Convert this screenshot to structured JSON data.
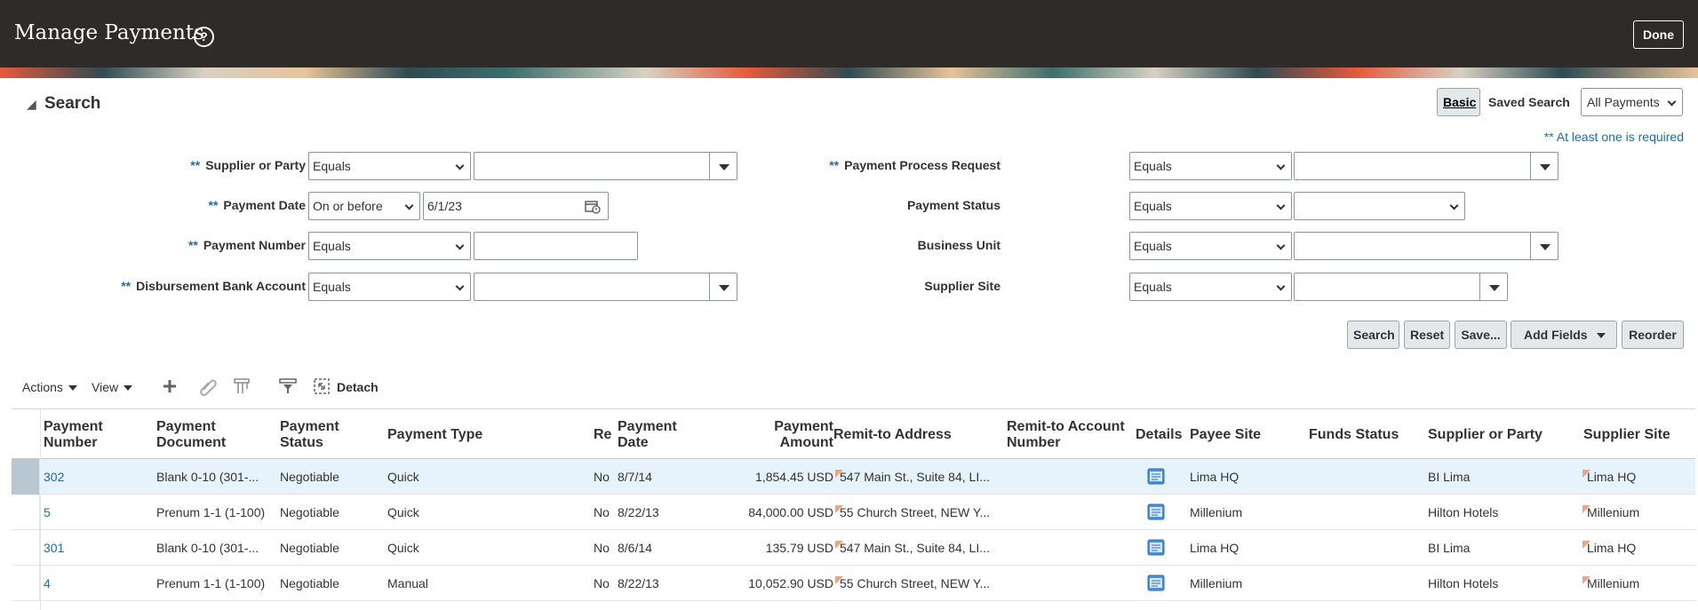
{
  "header": {
    "title": "Manage Payments",
    "help_label": "?",
    "done_label": "Done"
  },
  "search": {
    "title": "Search",
    "basic_label": "Basic",
    "saved_search_label": "Saved Search",
    "saved_search_value": "All Payments",
    "required_note": "** At least one is required",
    "required_mark": "**",
    "left_fields": [
      {
        "label": "Supplier or Party",
        "required": true,
        "operator": "Equals",
        "value": ""
      },
      {
        "label": "Payment Date",
        "required": true,
        "operator": "On or before",
        "value": "6/1/23"
      },
      {
        "label": "Payment Number",
        "required": true,
        "operator": "Equals",
        "value": ""
      },
      {
        "label": "Disbursement Bank Account",
        "required": true,
        "operator": "Equals",
        "value": ""
      }
    ],
    "right_fields": [
      {
        "label": "Payment Process Request",
        "required": true,
        "operator": "Equals",
        "value": ""
      },
      {
        "label": "Payment Status",
        "required": false,
        "operator": "Equals",
        "value": ""
      },
      {
        "label": "Business Unit",
        "required": false,
        "operator": "Equals",
        "value": ""
      },
      {
        "label": "Supplier Site",
        "required": false,
        "operator": "Equals",
        "value": ""
      }
    ],
    "buttons": {
      "search": "Search",
      "reset": "Reset",
      "save": "Save...",
      "add_fields": "Add Fields",
      "reorder": "Reorder"
    }
  },
  "toolbar": {
    "actions": "Actions",
    "view": "View",
    "detach": "Detach"
  },
  "table": {
    "columns": [
      "Payment Number",
      "Payment Document",
      "Payment Status",
      "Payment Type",
      "Re",
      "Payment Date",
      "Payment Amount",
      "Remit-to Address",
      "Remit-to Account Number",
      "Details",
      "Payee Site",
      "Funds Status",
      "Supplier or Party",
      "Supplier Site"
    ],
    "rows": [
      {
        "number": "302",
        "document": "Blank 0-10 (301-...",
        "status": "Negotiable",
        "type": "Quick",
        "re": "No",
        "date": "8/7/14",
        "amount": "1,854.45 USD",
        "remit_address": "547 Main St., Suite 84, LI...",
        "remit_account": "",
        "payee_site": "Lima HQ",
        "funds_status": "",
        "supplier": "BI Lima",
        "supplier_site": "Lima HQ"
      },
      {
        "number": "5",
        "document": "Prenum 1-1 (1-100)",
        "status": "Negotiable",
        "type": "Quick",
        "re": "No",
        "date": "8/22/13",
        "amount": "84,000.00 USD",
        "remit_address": "55 Church Street, NEW Y...",
        "remit_account": "",
        "payee_site": "Millenium",
        "funds_status": "",
        "supplier": "Hilton Hotels",
        "supplier_site": "Millenium"
      },
      {
        "number": "301",
        "document": "Blank 0-10 (301-...",
        "status": "Negotiable",
        "type": "Quick",
        "re": "No",
        "date": "8/6/14",
        "amount": "135.79 USD",
        "remit_address": "547 Main St., Suite 84, LI...",
        "remit_account": "",
        "payee_site": "Lima HQ",
        "funds_status": "",
        "supplier": "BI Lima",
        "supplier_site": "Lima HQ"
      },
      {
        "number": "4",
        "document": "Prenum 1-1 (1-100)",
        "status": "Negotiable",
        "type": "Manual",
        "re": "No",
        "date": "8/22/13",
        "amount": "10,052.90 USD",
        "remit_address": "55 Church Street, NEW Y...",
        "remit_account": "",
        "payee_site": "Millenium",
        "funds_status": "",
        "supplier": "Hilton Hotels",
        "supplier_site": "Millenium"
      }
    ]
  },
  "colors": {
    "header_bg": "#2f2b28",
    "link": "#1a6fa8",
    "selected_row": "#e6f2fc"
  }
}
